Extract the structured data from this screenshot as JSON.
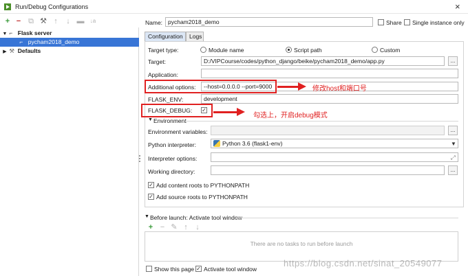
{
  "window": {
    "title": "Run/Debug Configurations",
    "close_glyph": "×"
  },
  "toolbar": {
    "add": "+",
    "remove": "−",
    "copy": "⧉",
    "edit_defaults": "⚒",
    "move_up": "↑",
    "move_down": "↓",
    "folder": "▬",
    "sort": "↓a"
  },
  "tree": {
    "flask_server": "Flask server",
    "config_item": "pycham2018_demo",
    "defaults": "Defaults",
    "expanded_glyph": "▼",
    "collapsed_glyph": "▶"
  },
  "header": {
    "name_label": "Name:",
    "name_value": "pycham2018_demo",
    "share_label": "Share",
    "single_instance_label": "Single instance only"
  },
  "tabs": {
    "configuration": "Configuration",
    "logs": "Logs"
  },
  "form": {
    "target_type_label": "Target type:",
    "target_options": [
      "Module name",
      "Script path",
      "Custom"
    ],
    "selected_target": "Script path",
    "target_label": "Target:",
    "target_value": "D:/VIPCourse/codes/python_django/beike/pycham2018_demo/app.py",
    "application_label": "Application:",
    "application_value": "",
    "additional_options_label": "Additional options:",
    "additional_options_value": "--host=0.0.0.0 --port=9000",
    "flask_env_label": "FLASK_ENV:",
    "flask_env_value": "development",
    "flask_debug_label": "FLASK_DEBUG:",
    "flask_debug_checked": "✓",
    "environment_heading": "Environment",
    "env_vars_label": "Environment variables:",
    "python_interpreter_label": "Python interpreter:",
    "python_interpreter_value": "Python 3.6 (flask1-env)",
    "interpreter_options_label": "Interpreter options:",
    "working_dir_label": "Working directory:",
    "content_roots_label": "Add content roots to PYTHONPATH",
    "source_roots_label": "Add source roots to PYTHONPATH",
    "dots": "...",
    "check": "✓",
    "expand_glyph": "⤢"
  },
  "before_launch": {
    "heading": "Before launch: Activate tool window",
    "empty_text": "There are no tasks to run before launch",
    "add": "+",
    "remove": "−",
    "edit": "✎",
    "up": "↑",
    "down": "↓"
  },
  "bottom": {
    "show_page_label": "Show this page",
    "activate_tool_label": "Activate tool window"
  },
  "annotations": {
    "host_port": "修改host和端口号",
    "debug": "勾选上，开启debug模式"
  },
  "watermark": "https://blog.csdn.net/sinat_20549077",
  "colors": {
    "accent": "#3875d6",
    "annotation_red": "#e02020"
  }
}
